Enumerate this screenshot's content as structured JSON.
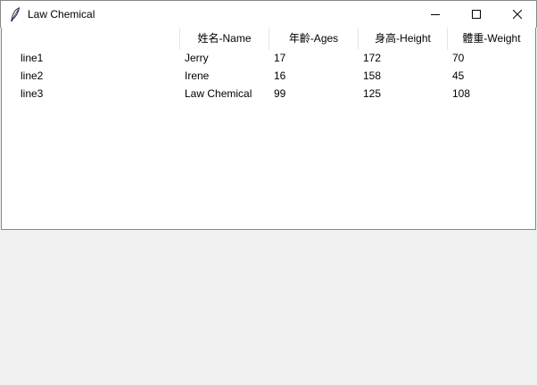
{
  "window": {
    "title": "Law Chemical",
    "icon": "feather-icon",
    "controls": {
      "minimize": "minimize-icon",
      "maximize": "maximize-icon",
      "close": "close-icon"
    }
  },
  "table": {
    "columns": [
      "",
      "姓名-Name",
      "年齡-Ages",
      "身高-Height",
      "體重-Weight"
    ],
    "rows": [
      [
        "line1",
        "Jerry",
        "17",
        "172",
        "70"
      ],
      [
        "line2",
        "Irene",
        "16",
        "158",
        "45"
      ],
      [
        "line3",
        "Law Chemical",
        "99",
        "125",
        "108"
      ]
    ]
  },
  "colors": {
    "titlebar": "#ffffff",
    "window_bg": "#f0f0f0",
    "tree_bg": "#ffffff",
    "tree_border": "#828790"
  }
}
